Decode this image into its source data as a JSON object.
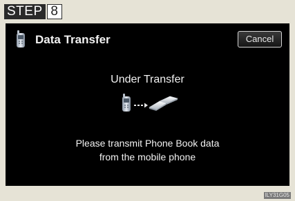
{
  "step": {
    "word": "STEP",
    "number": "8"
  },
  "screen": {
    "title": "Data Transfer",
    "title_icon": "mobile-phone-icon",
    "cancel_label": "Cancel",
    "status": "Under Transfer",
    "transfer_graphic": {
      "from_icon": "mobile-phone-icon",
      "arrow_icon": "dotted-arrow-icon",
      "to_icon": "phone-book-icon"
    },
    "message_line1": "Please transmit Phone Book data",
    "message_line2": "from the mobile phone"
  },
  "image_code": "ILY31G05",
  "colors": {
    "screen_background": "#000000",
    "page_background": "#e6e3d6",
    "text": "#f2f2f2"
  }
}
